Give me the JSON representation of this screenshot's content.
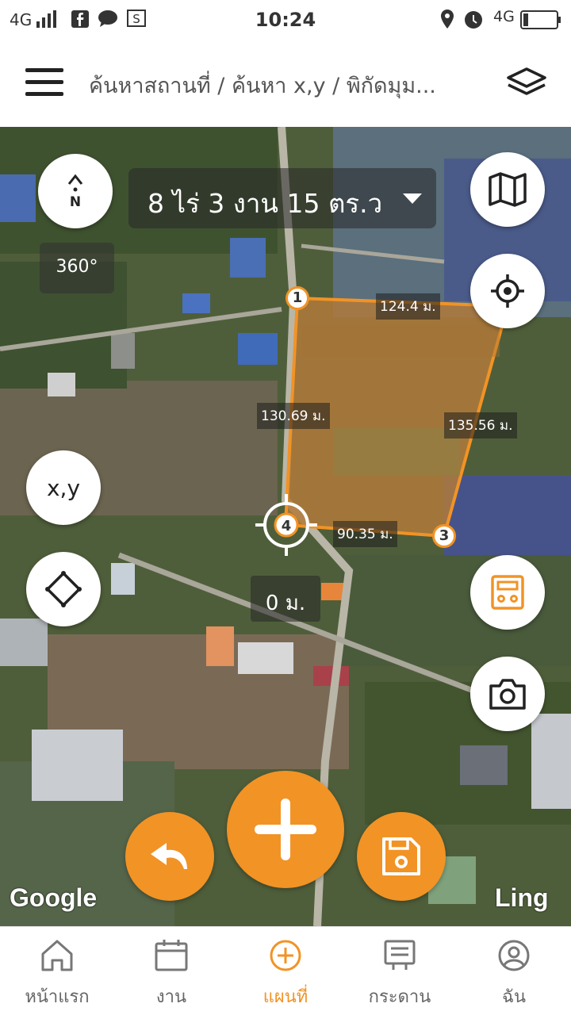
{
  "status_bar": {
    "network_left": "4G",
    "time": "10:24",
    "network_right": "4G"
  },
  "header": {
    "breadcrumb": "ค้นหาสถานที่ / ค้นหา x,y / พิกัดมุม..."
  },
  "map": {
    "area_text": "8 ไร่ 3 งาน 15 ตร.ว",
    "compass_letter": "N",
    "compass_360": "360°",
    "xy_button_label": "x,y",
    "distance_labels": {
      "side_1_2": "124.4 ม.",
      "side_2_3": "135.56 ม.",
      "side_3_4": "90.35 ม.",
      "side_4_1": "130.69 ม."
    },
    "current_distance": "0 ม.",
    "vertex_labels": [
      "1",
      "3",
      "4"
    ],
    "google_watermark": "Google",
    "ling_watermark": "Ling",
    "accent_color": "#f29325"
  },
  "bottom_nav": {
    "items": [
      {
        "label": "หน้าแรก",
        "icon": "home-icon"
      },
      {
        "label": "งาน",
        "icon": "calendar-icon"
      },
      {
        "label": "แผนที่",
        "icon": "plus-circle-icon"
      },
      {
        "label": "กระดาน",
        "icon": "board-icon"
      },
      {
        "label": "ฉัน",
        "icon": "profile-icon"
      }
    ],
    "active_index": 2
  }
}
